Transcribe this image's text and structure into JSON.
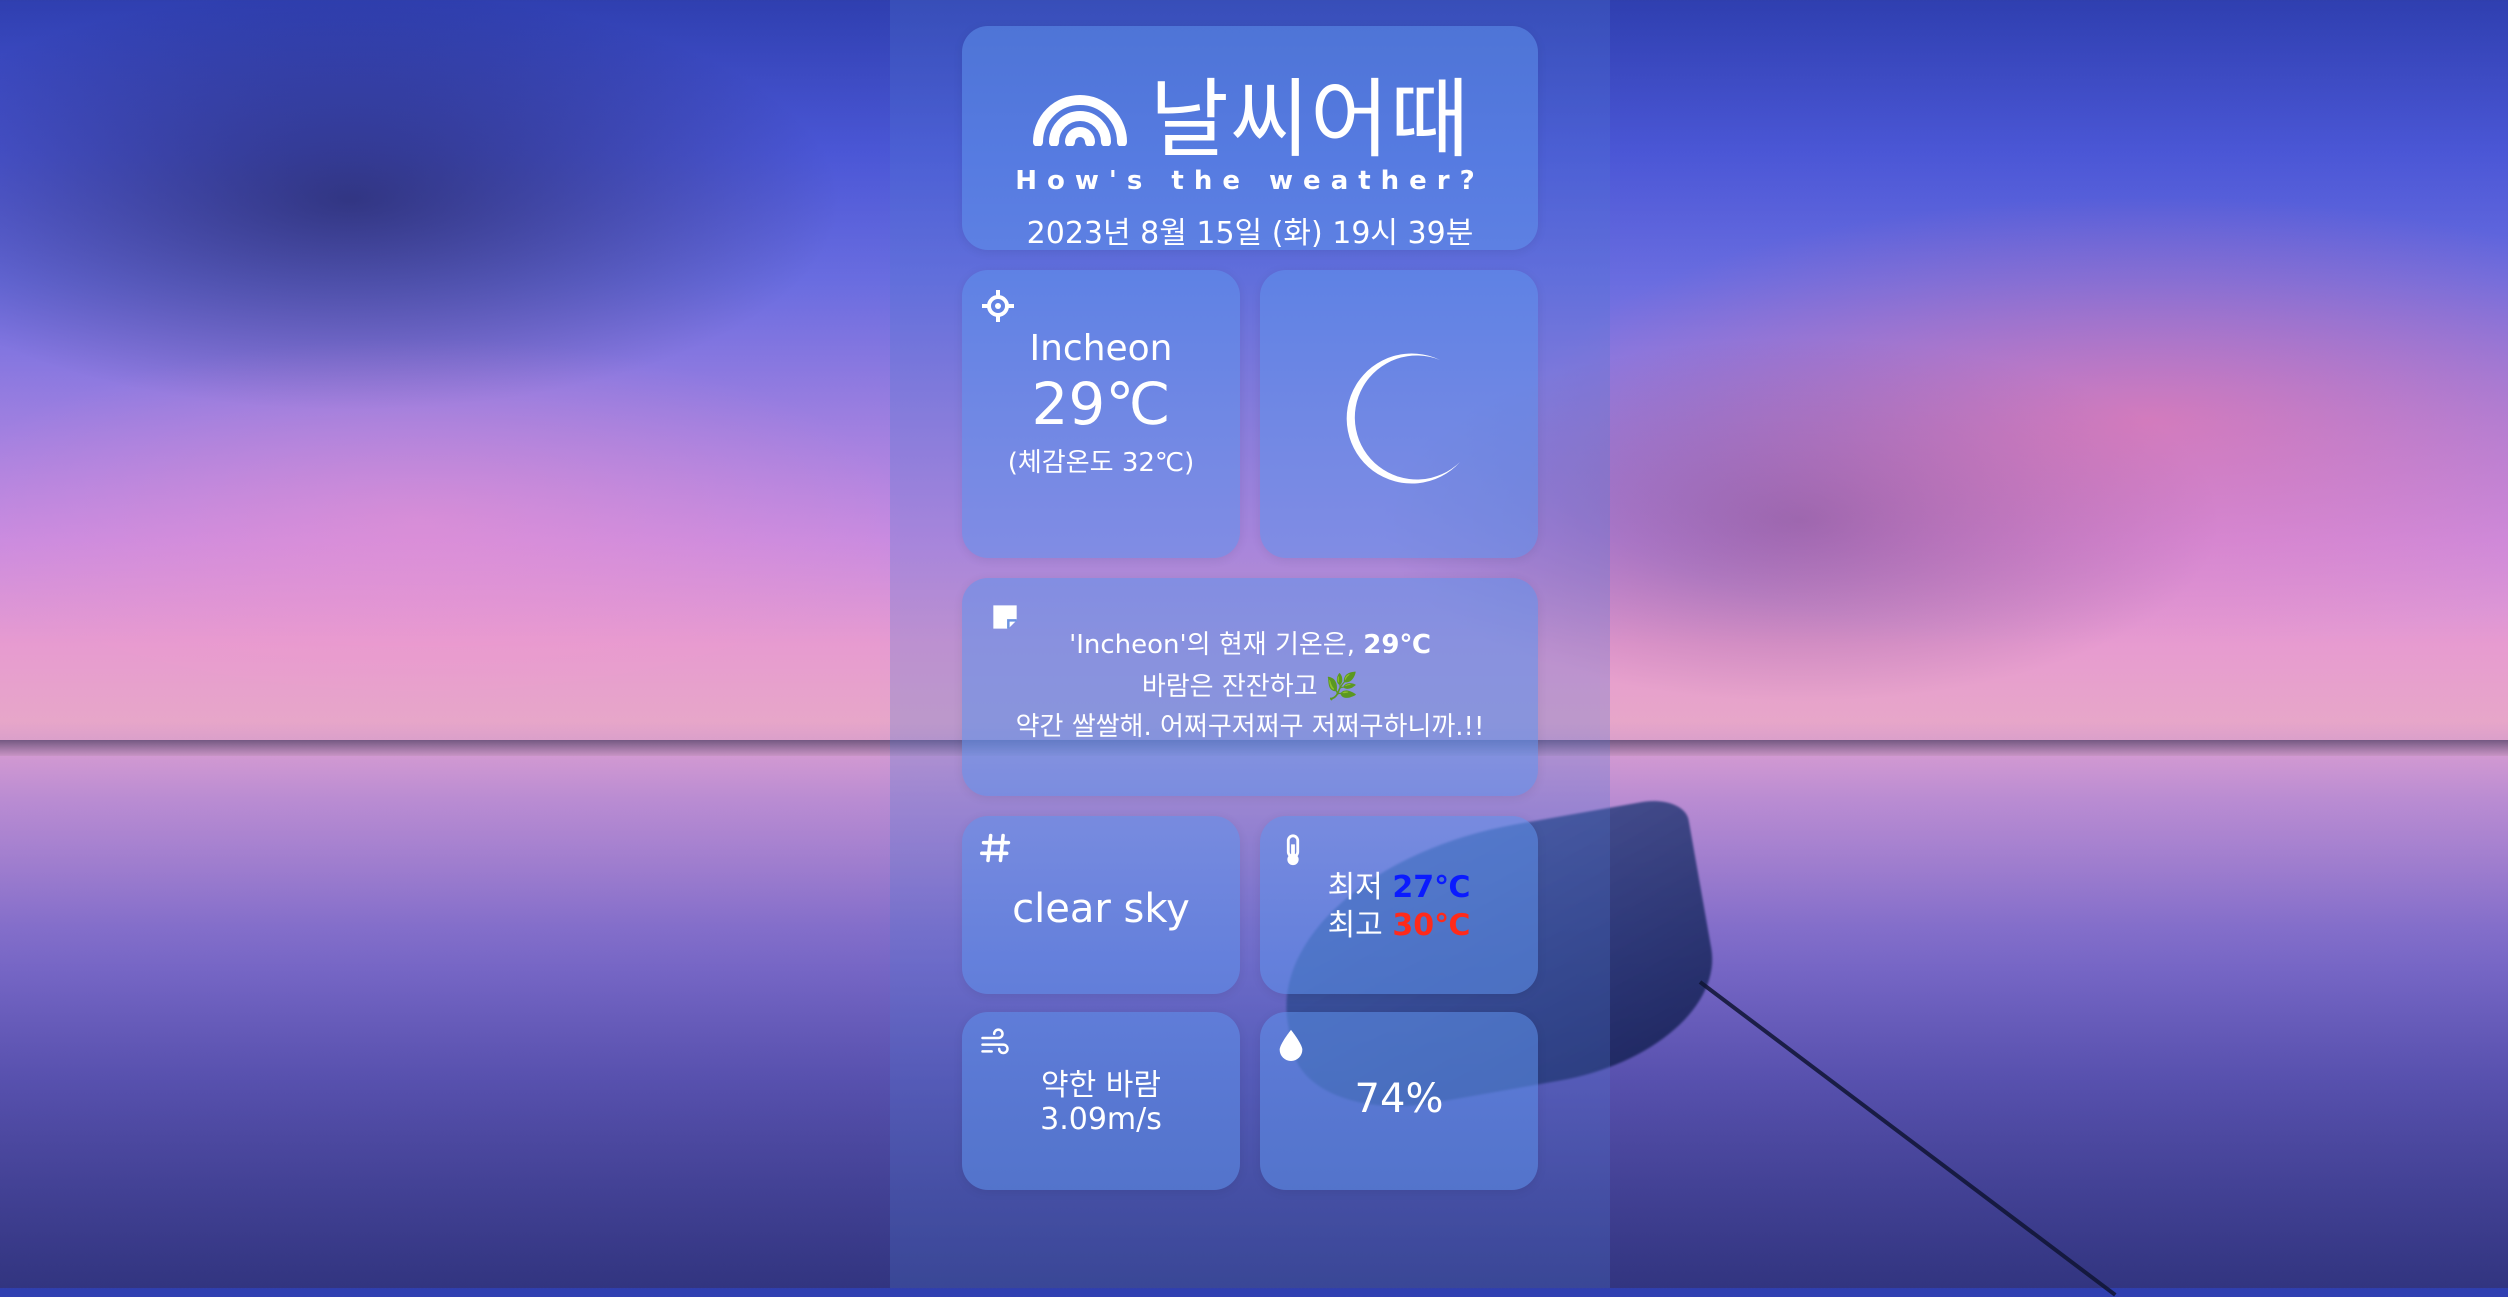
{
  "header": {
    "title": "날씨어때",
    "subtitle": "How's the weather?",
    "datetime": "2023년 8월 15일 (화) 19시 39분"
  },
  "location": {
    "icon": "crosshair-location-icon",
    "city": "Incheon",
    "temperature": "29℃",
    "feels_like": "(체감온도 32℃)"
  },
  "weather_icon": {
    "icon": "moon-icon"
  },
  "message": {
    "icon": "memo-icon",
    "line1_prefix": "'Incheon'의 현재 기온은, ",
    "line1_temp": "29℃",
    "line2": "바람은 잔잔하고 🌿",
    "line3": "약간 쌀쌀해. 어쩌구저쩌구 저쩌구하니까.!!"
  },
  "description": {
    "icon": "hash-icon",
    "text": "clear sky"
  },
  "minmax": {
    "icon": "thermometer-icon",
    "min_label": "최저 ",
    "min_value": "27℃",
    "max_label": "최고 ",
    "max_value": "30℃",
    "min_color": "#0a1bff",
    "max_color": "#ff2a1a"
  },
  "wind": {
    "icon": "wind-icon",
    "label": "약한 바람",
    "speed": "3.09m/s"
  },
  "humidity": {
    "icon": "droplet-icon",
    "value": "74%"
  }
}
